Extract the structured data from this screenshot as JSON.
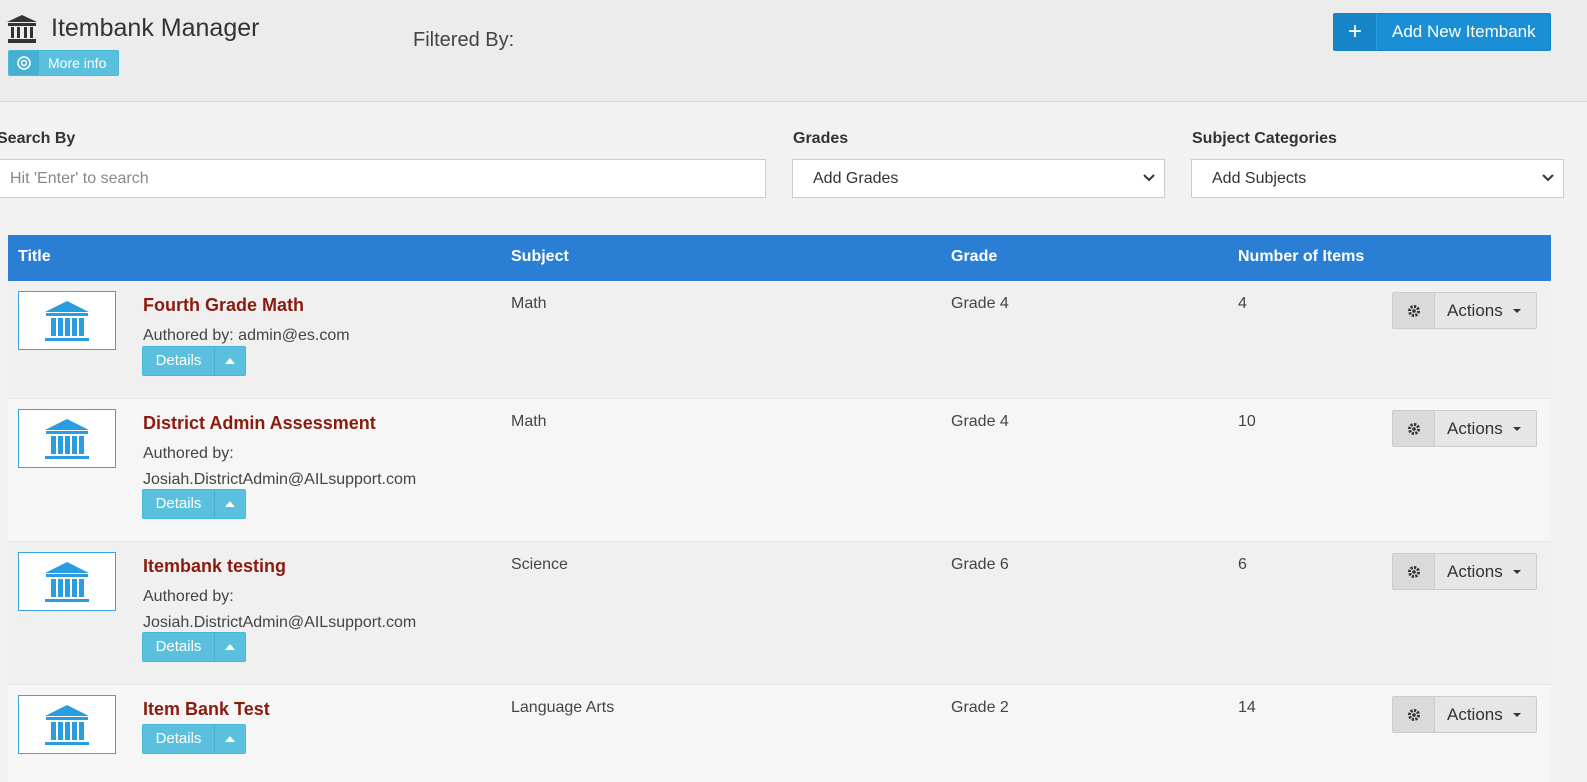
{
  "header": {
    "title": "Itembank Manager",
    "more_info_label": "More info",
    "filtered_by_label": "Filtered By:",
    "add_button_icon": "+",
    "add_button_label": "Add New Itembank"
  },
  "filters": {
    "search_label": "Search By",
    "search_placeholder": "Hit 'Enter' to search",
    "grades_label": "Grades",
    "grades_value": "Add Grades",
    "subjects_label": "Subject Categories",
    "subjects_value": "Add Subjects"
  },
  "table": {
    "columns": [
      "Title",
      "Subject",
      "Grade",
      "Number of Items"
    ],
    "details_label": "Details",
    "actions_label": "Actions",
    "rows": [
      {
        "title": "Fourth Grade Math",
        "author_line1": "Authored by: admin@es.com",
        "author_line2": "",
        "subject": "Math",
        "grade": "Grade 4",
        "items": "4"
      },
      {
        "title": "District Admin Assessment",
        "author_line1": "Authored by:",
        "author_line2": "Josiah.DistrictAdmin@AILsupport.com",
        "subject": "Math",
        "grade": "Grade 4",
        "items": "10"
      },
      {
        "title": "Itembank testing",
        "author_line1": "Authored by:",
        "author_line2": "Josiah.DistrictAdmin@AILsupport.com",
        "subject": "Science",
        "grade": "Grade 6",
        "items": "6"
      },
      {
        "title": "Item Bank Test",
        "author_line1": "",
        "author_line2": "",
        "subject": "Language Arts",
        "grade": "Grade 2",
        "items": "14"
      }
    ]
  },
  "colors": {
    "header_bar": "#2a7fd4",
    "title_link": "#8a1c0f",
    "info_button": "#5bc0de",
    "primary_button": "#1a8fd6"
  }
}
